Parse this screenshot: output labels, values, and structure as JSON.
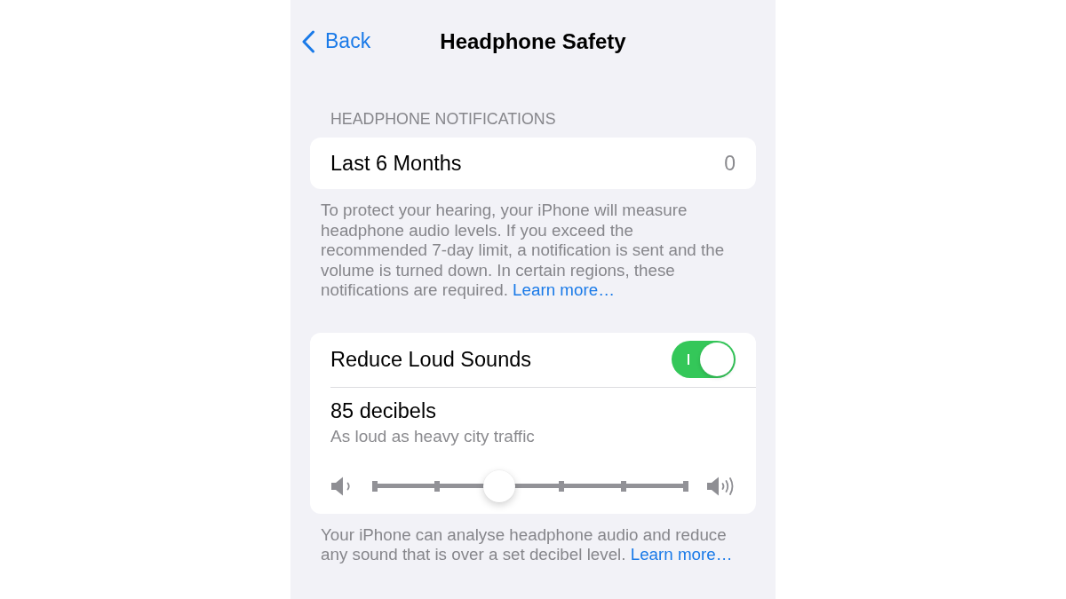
{
  "nav": {
    "back": "Back",
    "title": "Headphone Safety"
  },
  "sections": [
    {
      "header": "HEADPHONE NOTIFICATIONS",
      "rows": [
        {
          "kind": "value",
          "label": "Last 6 Months",
          "value": "0"
        }
      ],
      "footer": {
        "text": "To protect your hearing, your iPhone will measure headphone audio levels. If you exceed the recommended 7-day limit, a notification is sent and the volume is turned down. In certain regions, these notifications are required.",
        "link": "Learn more…"
      }
    },
    {
      "rows": [
        {
          "kind": "toggle",
          "label": "Reduce Loud Sounds",
          "on": true
        },
        {
          "kind": "slider",
          "title": "85 decibels",
          "subtitle": "As loud as heavy city traffic",
          "level": 0.4
        }
      ],
      "footer": {
        "text": "Your iPhone can analyse headphone audio and reduce any sound that is over a set decibel level.",
        "link": "Learn more…"
      }
    }
  ]
}
